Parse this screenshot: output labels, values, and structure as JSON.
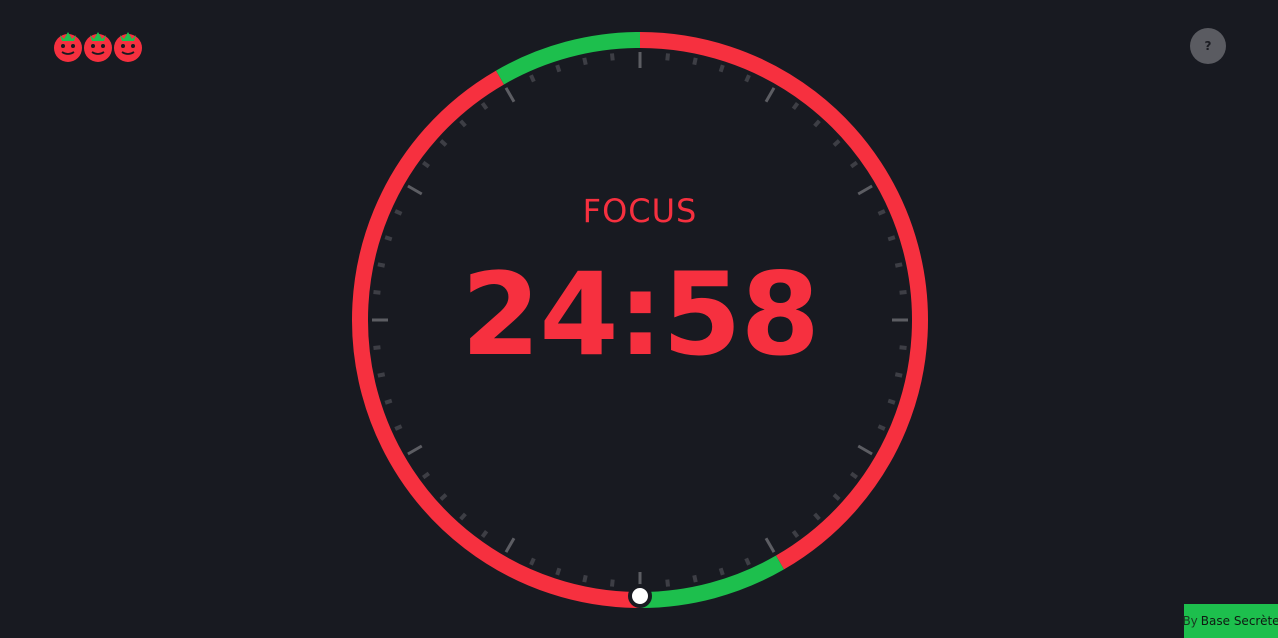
{
  "logo": {
    "count": 3,
    "icon": "tomato-icon"
  },
  "help": {
    "label": "?"
  },
  "timer": {
    "mode": "FOCUS",
    "time": "24:58",
    "colors": {
      "focus": "#f6303f",
      "break": "#1dbf4d",
      "track": "#181a21",
      "tick": "#5c5d63"
    }
  },
  "credit": {
    "prefix": "By",
    "brand": "Base Secrète"
  }
}
